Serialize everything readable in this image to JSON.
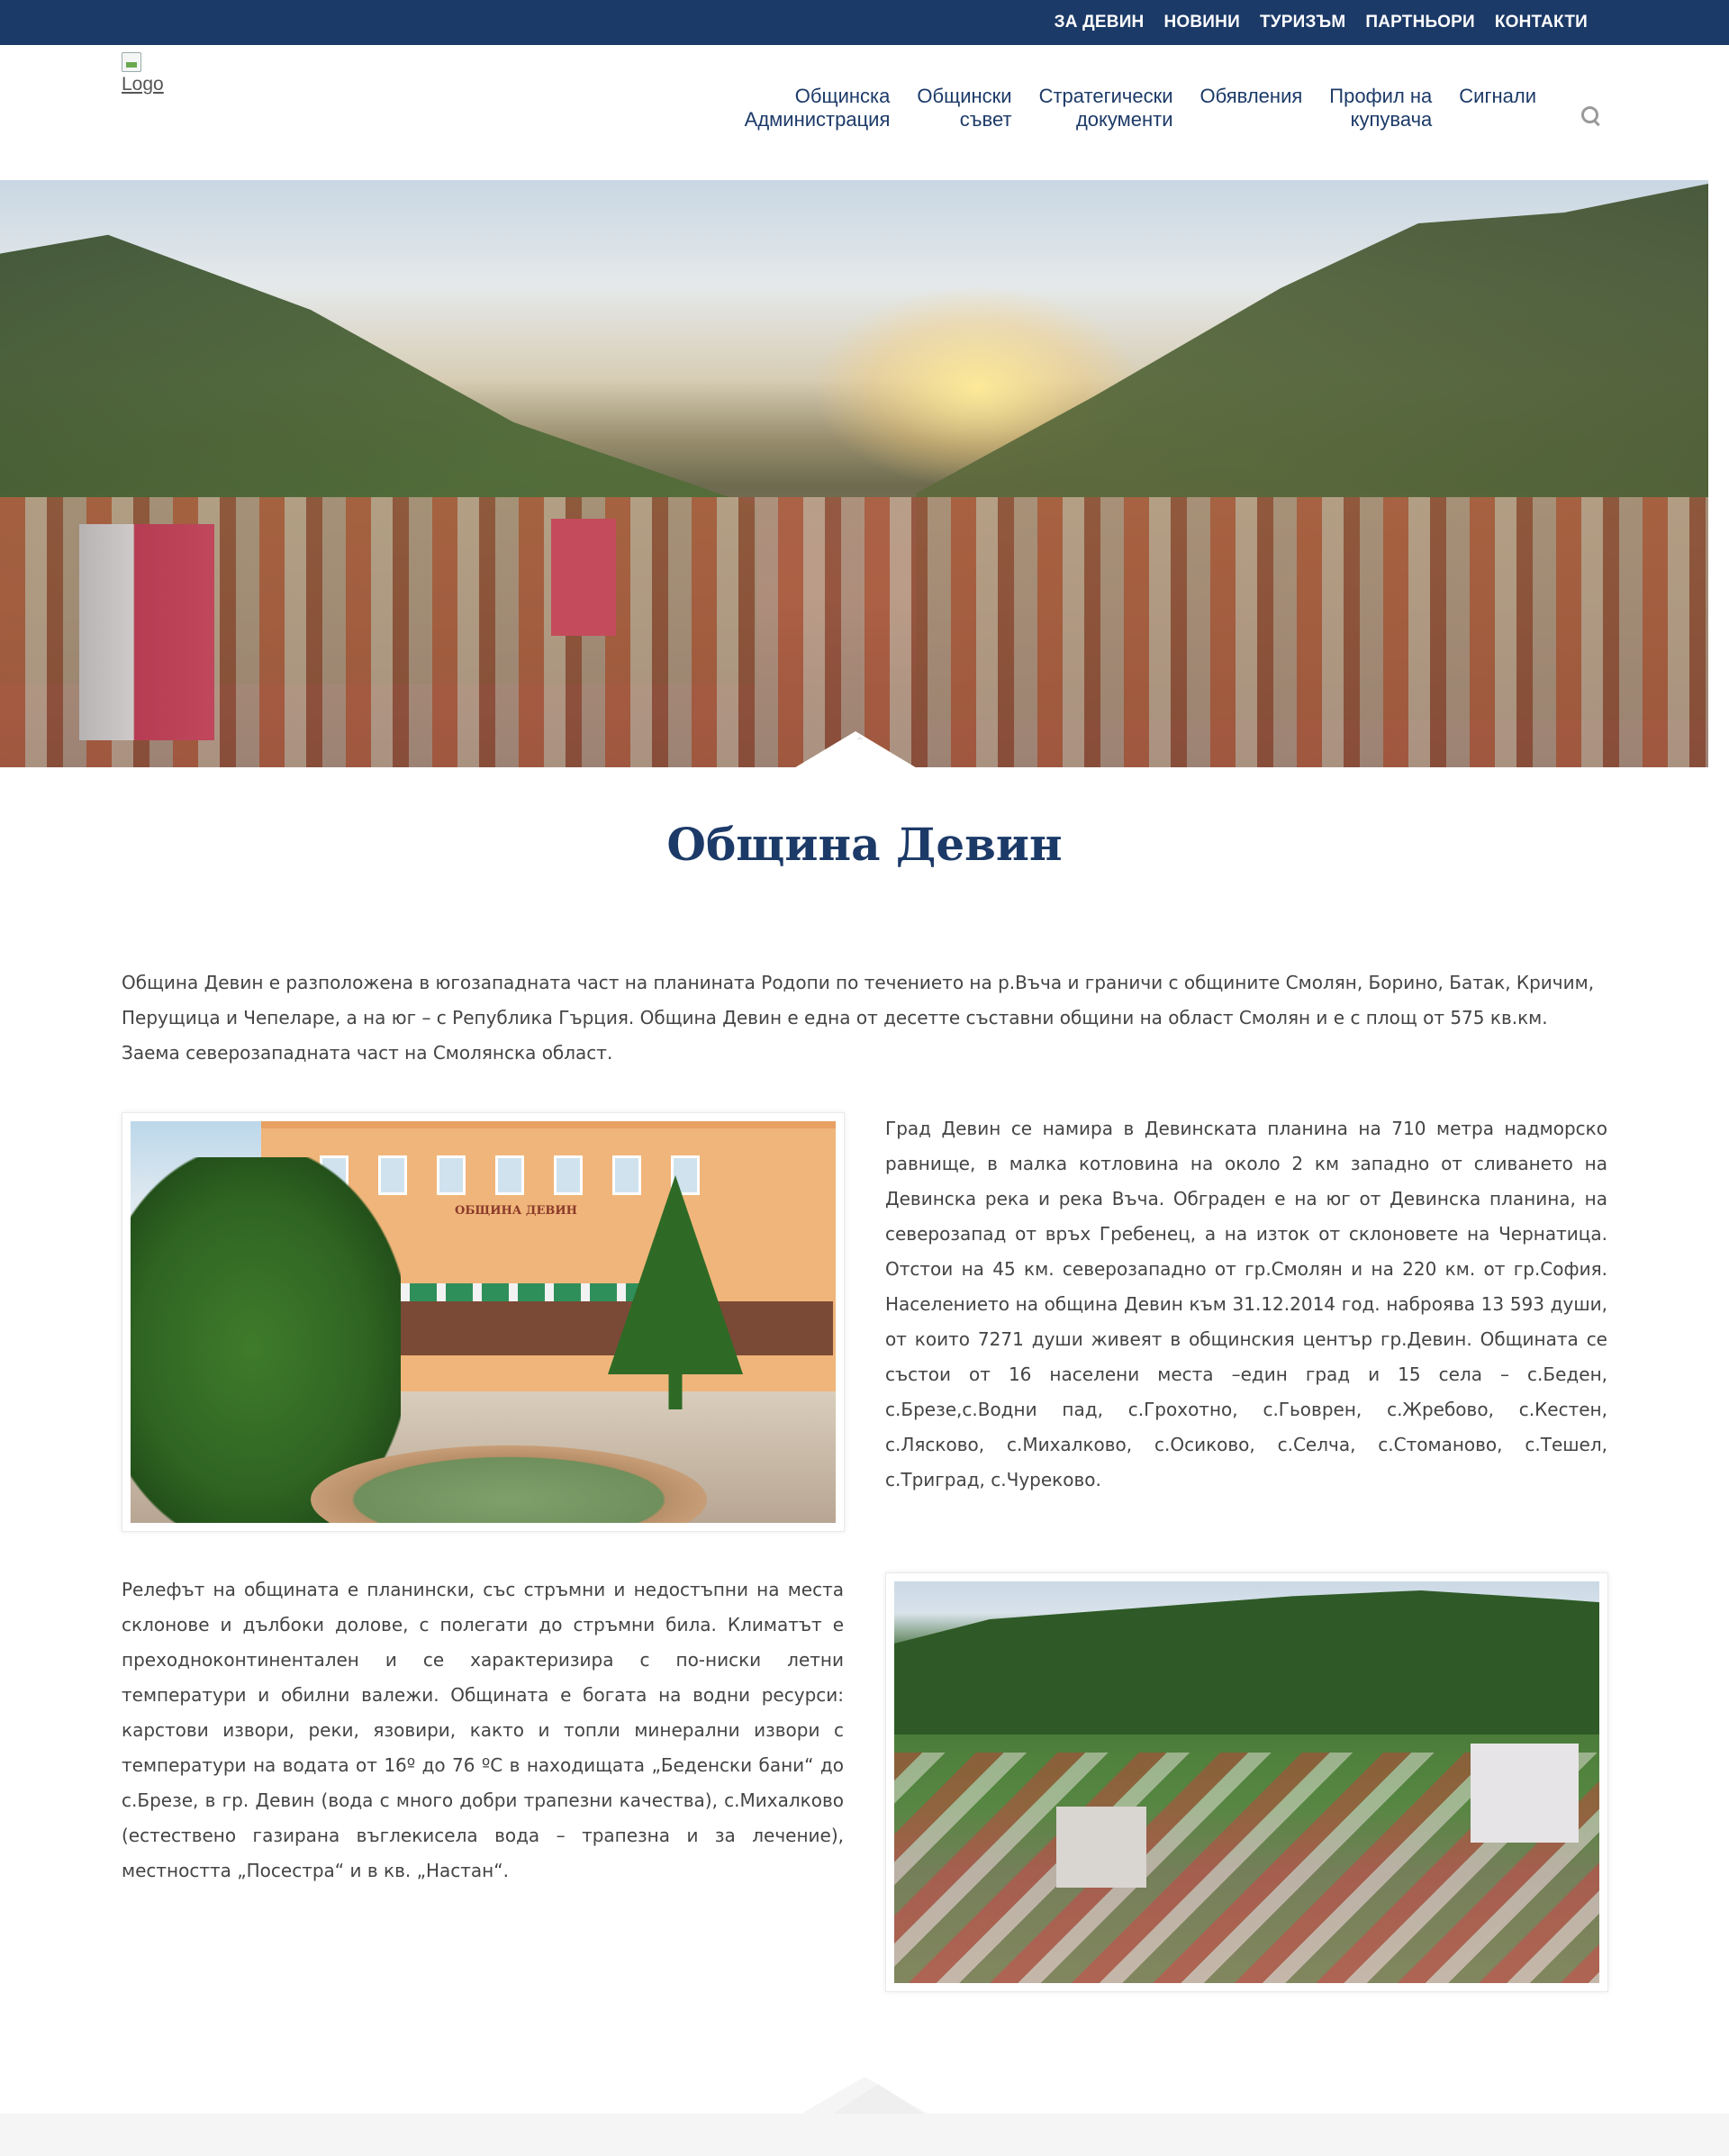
{
  "topnav": [
    "ЗА ДЕВИН",
    "НОВИНИ",
    "ТУРИЗЪМ",
    "ПАРТНЬОРИ",
    "КОНТАКТИ"
  ],
  "logo": {
    "alt": "Logo"
  },
  "mainnav": [
    {
      "line1": "Общинска",
      "line2": "Администрация"
    },
    {
      "line1": "Общински",
      "line2": "съвет"
    },
    {
      "line1": "Стратегически",
      "line2": "документи"
    },
    {
      "line1": "Обявления",
      "line2": ""
    },
    {
      "line1": "Профил на",
      "line2": "купувача"
    },
    {
      "line1": "Сигнали",
      "line2": ""
    }
  ],
  "colors": {
    "primary": "#1c3a68",
    "text": "#444444",
    "footer": "#f5f5f5"
  },
  "icons": {
    "search": "search-icon"
  },
  "page": {
    "title": "Община Девин",
    "intro": "Община Девин е разположена в югозападната част на планината Родопи по течението на р.Въча и граничи с общините Смолян, Борино, Батак, Кричим, Перущица и Чепеларе, а на юг – с Република Гърция. Община Девин е една от десетте съставни общини на област Смолян и е с площ от 575 кв.км. Заема северозападната част на Смолянска област.",
    "section1": "Град Девин се намира в Девинската планина на 710 метра надморско равнище, в малка котловина на около 2 км западно от сливането на Девинска река и река Въча. Обграден е на юг от Девинска планина, на северозапад от връх Гребенец, а на изток от склоновете на Чернатица. Отстои на 45 км. северозападно от гр.Смолян и на 220 км. от гр.София. Населението на община Девин към 31.12.2014 год. наброява 13 593 души, от които 7271 души живеят в общинския център гр.Девин. Общината се състои от 16 населени места –един град и 15 села – с.Беден, с.Брезе,с.Водни пад, с.Грохотно, с.Гьоврен, с.Жребово, с.Кестен, с.Лясково, с.Михалково, с.Осиково, с.Селча, с.Стоманово, с.Тешел, с.Триград, с.Чуреково.",
    "section2": "Релефът на общината е планински, със стръмни и недостъпни на места склонове и дълбоки долове, с полегати до стръмни била. Климатът е преходноконтинентален и се характеризира с по-ниски летни температури и обилни валежи. Общината е богата на водни ресурси: карстови извори, реки, язовири, както и топли минерални извори с температури на водата от 16º до 76 ºС в находищата „Беденски бани“ до с.Брезе, в гр. Девин (вода с много добри трапезни качества), с.Михалково (естествено газирана въглекисела вода – трапезна и за лечение), местността „Посестра“ и в кв. „Настан“.",
    "building_sign": "ОБЩИНА ДЕВИН"
  }
}
